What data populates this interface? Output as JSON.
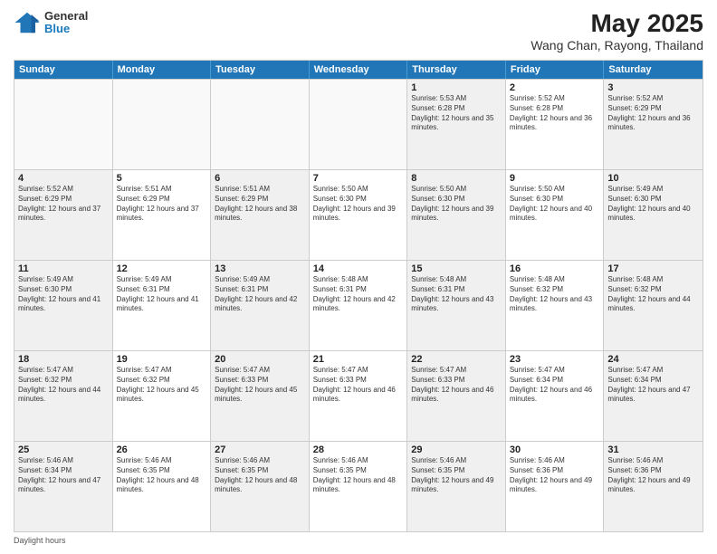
{
  "title": "May 2025",
  "subtitle": "Wang Chan, Rayong, Thailand",
  "logo": {
    "line1": "General",
    "line2": "Blue"
  },
  "days": [
    "Sunday",
    "Monday",
    "Tuesday",
    "Wednesday",
    "Thursday",
    "Friday",
    "Saturday"
  ],
  "weeks": [
    [
      {
        "day": "",
        "empty": true
      },
      {
        "day": "",
        "empty": true
      },
      {
        "day": "",
        "empty": true
      },
      {
        "day": "",
        "empty": true
      },
      {
        "day": "1",
        "sunrise": "5:53 AM",
        "sunset": "6:28 PM",
        "daylight": "12 hours and 35 minutes."
      },
      {
        "day": "2",
        "sunrise": "5:52 AM",
        "sunset": "6:28 PM",
        "daylight": "12 hours and 36 minutes."
      },
      {
        "day": "3",
        "sunrise": "5:52 AM",
        "sunset": "6:29 PM",
        "daylight": "12 hours and 36 minutes."
      }
    ],
    [
      {
        "day": "4",
        "sunrise": "5:52 AM",
        "sunset": "6:29 PM",
        "daylight": "12 hours and 37 minutes."
      },
      {
        "day": "5",
        "sunrise": "5:51 AM",
        "sunset": "6:29 PM",
        "daylight": "12 hours and 37 minutes."
      },
      {
        "day": "6",
        "sunrise": "5:51 AM",
        "sunset": "6:29 PM",
        "daylight": "12 hours and 38 minutes."
      },
      {
        "day": "7",
        "sunrise": "5:50 AM",
        "sunset": "6:30 PM",
        "daylight": "12 hours and 39 minutes."
      },
      {
        "day": "8",
        "sunrise": "5:50 AM",
        "sunset": "6:30 PM",
        "daylight": "12 hours and 39 minutes."
      },
      {
        "day": "9",
        "sunrise": "5:50 AM",
        "sunset": "6:30 PM",
        "daylight": "12 hours and 40 minutes."
      },
      {
        "day": "10",
        "sunrise": "5:49 AM",
        "sunset": "6:30 PM",
        "daylight": "12 hours and 40 minutes."
      }
    ],
    [
      {
        "day": "11",
        "sunrise": "5:49 AM",
        "sunset": "6:30 PM",
        "daylight": "12 hours and 41 minutes."
      },
      {
        "day": "12",
        "sunrise": "5:49 AM",
        "sunset": "6:31 PM",
        "daylight": "12 hours and 41 minutes."
      },
      {
        "day": "13",
        "sunrise": "5:49 AM",
        "sunset": "6:31 PM",
        "daylight": "12 hours and 42 minutes."
      },
      {
        "day": "14",
        "sunrise": "5:48 AM",
        "sunset": "6:31 PM",
        "daylight": "12 hours and 42 minutes."
      },
      {
        "day": "15",
        "sunrise": "5:48 AM",
        "sunset": "6:31 PM",
        "daylight": "12 hours and 43 minutes."
      },
      {
        "day": "16",
        "sunrise": "5:48 AM",
        "sunset": "6:32 PM",
        "daylight": "12 hours and 43 minutes."
      },
      {
        "day": "17",
        "sunrise": "5:48 AM",
        "sunset": "6:32 PM",
        "daylight": "12 hours and 44 minutes."
      }
    ],
    [
      {
        "day": "18",
        "sunrise": "5:47 AM",
        "sunset": "6:32 PM",
        "daylight": "12 hours and 44 minutes."
      },
      {
        "day": "19",
        "sunrise": "5:47 AM",
        "sunset": "6:32 PM",
        "daylight": "12 hours and 45 minutes."
      },
      {
        "day": "20",
        "sunrise": "5:47 AM",
        "sunset": "6:33 PM",
        "daylight": "12 hours and 45 minutes."
      },
      {
        "day": "21",
        "sunrise": "5:47 AM",
        "sunset": "6:33 PM",
        "daylight": "12 hours and 46 minutes."
      },
      {
        "day": "22",
        "sunrise": "5:47 AM",
        "sunset": "6:33 PM",
        "daylight": "12 hours and 46 minutes."
      },
      {
        "day": "23",
        "sunrise": "5:47 AM",
        "sunset": "6:34 PM",
        "daylight": "12 hours and 46 minutes."
      },
      {
        "day": "24",
        "sunrise": "5:47 AM",
        "sunset": "6:34 PM",
        "daylight": "12 hours and 47 minutes."
      }
    ],
    [
      {
        "day": "25",
        "sunrise": "5:46 AM",
        "sunset": "6:34 PM",
        "daylight": "12 hours and 47 minutes."
      },
      {
        "day": "26",
        "sunrise": "5:46 AM",
        "sunset": "6:35 PM",
        "daylight": "12 hours and 48 minutes."
      },
      {
        "day": "27",
        "sunrise": "5:46 AM",
        "sunset": "6:35 PM",
        "daylight": "12 hours and 48 minutes."
      },
      {
        "day": "28",
        "sunrise": "5:46 AM",
        "sunset": "6:35 PM",
        "daylight": "12 hours and 48 minutes."
      },
      {
        "day": "29",
        "sunrise": "5:46 AM",
        "sunset": "6:35 PM",
        "daylight": "12 hours and 49 minutes."
      },
      {
        "day": "30",
        "sunrise": "5:46 AM",
        "sunset": "6:36 PM",
        "daylight": "12 hours and 49 minutes."
      },
      {
        "day": "31",
        "sunrise": "5:46 AM",
        "sunset": "6:36 PM",
        "daylight": "12 hours and 49 minutes."
      }
    ]
  ],
  "footer": "Daylight hours"
}
